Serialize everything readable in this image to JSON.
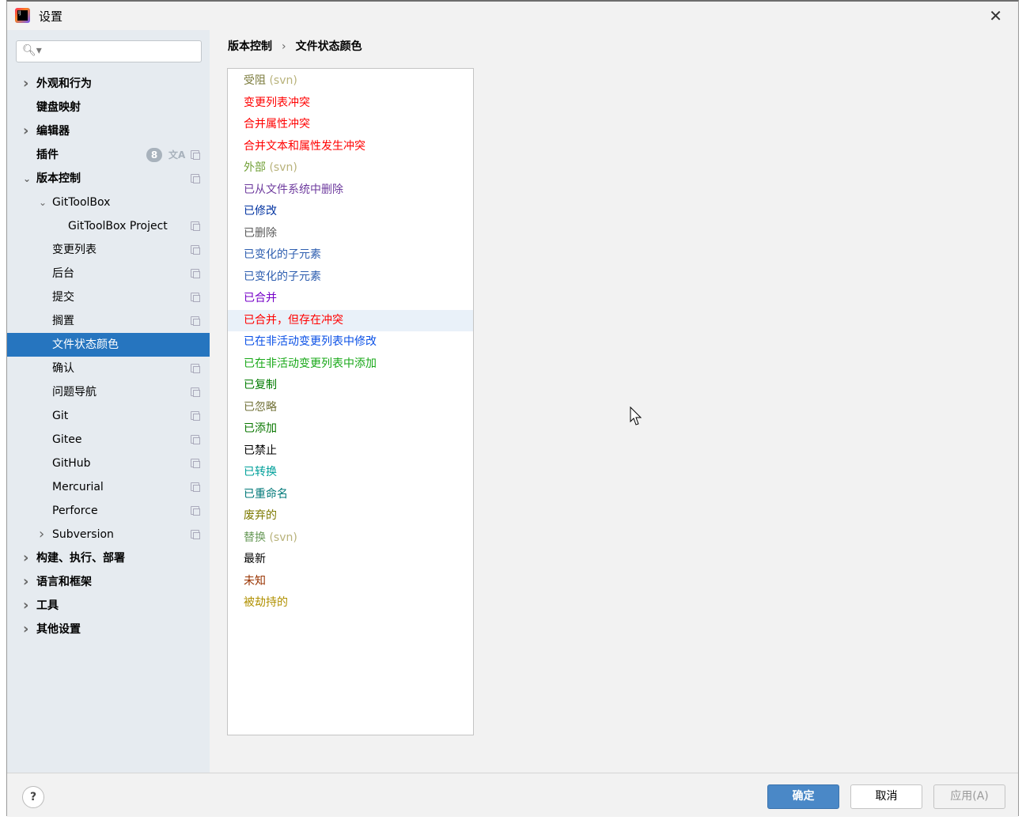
{
  "window": {
    "title": "设置",
    "close_icon": "close-icon"
  },
  "search": {
    "placeholder": "",
    "icon": "search-icon"
  },
  "sidebar": {
    "items": [
      {
        "label": "外观和行为",
        "level": 0,
        "expand": "collapsed",
        "bold": true
      },
      {
        "label": "键盘映射",
        "level": 0,
        "expand": "none",
        "bold": true
      },
      {
        "label": "编辑器",
        "level": 0,
        "expand": "collapsed",
        "bold": true
      },
      {
        "label": "插件",
        "level": 0,
        "expand": "none",
        "bold": true,
        "badge": "8"
      },
      {
        "label": "版本控制",
        "level": 0,
        "expand": "expanded",
        "bold": true
      },
      {
        "label": "GitToolBox",
        "level": 1,
        "expand": "expanded"
      },
      {
        "label": "GitToolBox Project",
        "level": 2,
        "expand": "none"
      },
      {
        "label": "变更列表",
        "level": 1,
        "expand": "none"
      },
      {
        "label": "后台",
        "level": 1,
        "expand": "none"
      },
      {
        "label": "提交",
        "level": 1,
        "expand": "none"
      },
      {
        "label": "搁置",
        "level": 1,
        "expand": "none"
      },
      {
        "label": "文件状态颜色",
        "level": 1,
        "expand": "none",
        "selected": true
      },
      {
        "label": "确认",
        "level": 1,
        "expand": "none"
      },
      {
        "label": "问题导航",
        "level": 1,
        "expand": "none"
      },
      {
        "label": "Git",
        "level": 1,
        "expand": "none"
      },
      {
        "label": "Gitee",
        "level": 1,
        "expand": "none"
      },
      {
        "label": "GitHub",
        "level": 1,
        "expand": "none"
      },
      {
        "label": "Mercurial",
        "level": 1,
        "expand": "none"
      },
      {
        "label": "Perforce",
        "level": 1,
        "expand": "none"
      },
      {
        "label": "Subversion",
        "level": 1,
        "expand": "collapsed"
      },
      {
        "label": "构建、执行、部署",
        "level": 0,
        "expand": "collapsed",
        "bold": true
      },
      {
        "label": "语言和框架",
        "level": 0,
        "expand": "collapsed",
        "bold": true
      },
      {
        "label": "工具",
        "level": 0,
        "expand": "collapsed",
        "bold": true
      },
      {
        "label": "其他设置",
        "level": 0,
        "expand": "collapsed",
        "bold": true
      }
    ]
  },
  "breadcrumb": {
    "parent": "版本控制",
    "separator": "›",
    "current": "文件状态颜色"
  },
  "file_status_colors": [
    {
      "label": "受阻",
      "suffix": " (svn)",
      "color": "#7b7b3c"
    },
    {
      "label": "变更列表冲突",
      "color": "#ff0000"
    },
    {
      "label": "合并属性冲突",
      "color": "#ff0000"
    },
    {
      "label": "合并文本和属性发生冲突",
      "color": "#ff0000"
    },
    {
      "label": "外部",
      "suffix": " (svn)",
      "color": "#72a038"
    },
    {
      "label": "已从文件系统中删除",
      "color": "#6e3b9e"
    },
    {
      "label": "已修改",
      "color": "#0032a0"
    },
    {
      "label": "已删除",
      "color": "#5a5a5a"
    },
    {
      "label": "已变化的子元素",
      "color": "#2f5fb0"
    },
    {
      "label": "已变化的子元素",
      "color": "#2f5fb0"
    },
    {
      "label": "已合并",
      "color": "#7500c8"
    },
    {
      "label": "已合并，但存在冲突",
      "color": "#ff0000",
      "highlighted": true
    },
    {
      "label": "已在非活动变更列表中修改",
      "color": "#0a50e6"
    },
    {
      "label": "已在非活动变更列表中添加",
      "color": "#18a818"
    },
    {
      "label": "已复制",
      "color": "#007b00"
    },
    {
      "label": "已忽略",
      "color": "#727238"
    },
    {
      "label": "已添加",
      "color": "#0a7700"
    },
    {
      "label": "已禁止",
      "color": "#000000"
    },
    {
      "label": "已转换",
      "color": "#00a09a"
    },
    {
      "label": "已重命名",
      "color": "#007878"
    },
    {
      "label": "废弃的",
      "color": "#7d7a00"
    },
    {
      "label": "替换",
      "suffix": " (svn)",
      "color": "#6a9a5a"
    },
    {
      "label": "最新",
      "color": "#000000"
    },
    {
      "label": "未知",
      "color": "#993300"
    },
    {
      "label": "被劫持的",
      "color": "#b09000"
    }
  ],
  "footer": {
    "help": "?",
    "ok": "确定",
    "cancel": "取消",
    "apply": "应用(A)"
  },
  "colors": {
    "sidebar_bg": "#e6ebf0",
    "selection": "#2675bf",
    "ok_button": "#4a88c7"
  }
}
